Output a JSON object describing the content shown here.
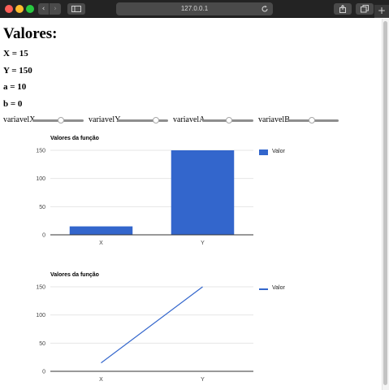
{
  "browser": {
    "url": "127.0.0.1",
    "new_tab_label": "+"
  },
  "page": {
    "heading": "Valores:",
    "variables": [
      {
        "label": "X = 15"
      },
      {
        "label": "Y = 150"
      },
      {
        "label": "a = 10"
      },
      {
        "label": "b = 0"
      }
    ],
    "sliders": [
      {
        "label": "variavelX",
        "position": 0.55
      },
      {
        "label": "variavelY",
        "position": 0.76
      },
      {
        "label": "variavelA",
        "position": 0.52
      },
      {
        "label": "variavelB",
        "position": 0.48
      }
    ]
  },
  "colors": {
    "series": "#3366cc",
    "gridline": "#e6e6e6",
    "baseline": "#333333"
  },
  "icons": [
    "chevron-left-icon",
    "chevron-right-icon",
    "sidebar-icon",
    "reload-icon",
    "share-icon",
    "tabs-icon",
    "plus-icon"
  ],
  "chart_data": [
    {
      "type": "bar",
      "title": "Valores da função",
      "categories": [
        "X",
        "Y"
      ],
      "series": [
        {
          "name": "Valor",
          "values": [
            15,
            150
          ]
        }
      ],
      "yticks": [
        0,
        50,
        100,
        150
      ],
      "ylim": [
        0,
        150
      ],
      "grid": true,
      "legend": "right"
    },
    {
      "type": "line",
      "title": "Valores da função",
      "categories": [
        "X",
        "Y"
      ],
      "series": [
        {
          "name": "Valor",
          "values": [
            15,
            150
          ]
        }
      ],
      "yticks": [
        0,
        50,
        100,
        150
      ],
      "ylim": [
        0,
        150
      ],
      "grid": true,
      "legend": "right"
    }
  ]
}
